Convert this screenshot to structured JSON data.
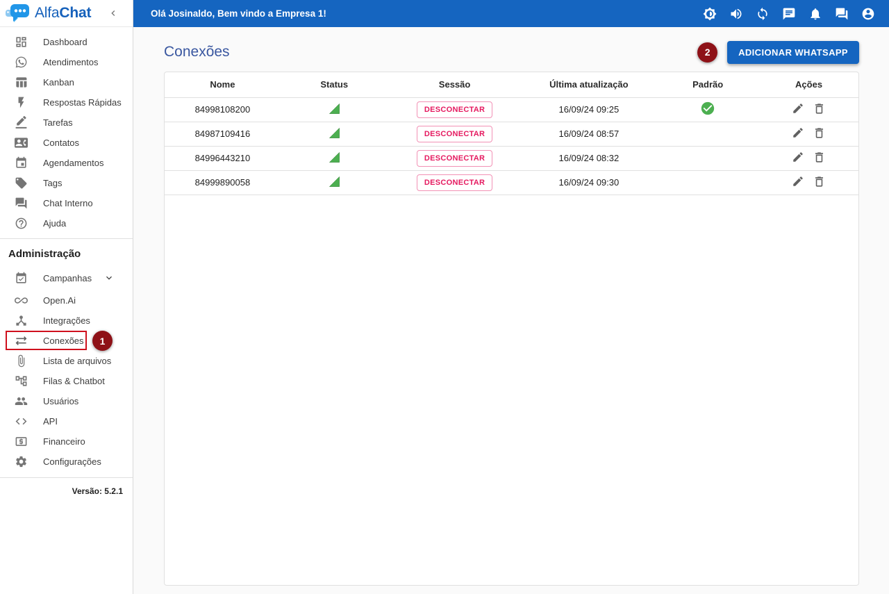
{
  "app": {
    "brand_alfa": "Alfa",
    "brand_chat": "Chat",
    "version_label": "Versão: 5.2.1"
  },
  "topbar": {
    "greeting": "Olá Josinaldo, Bem vindo a Empresa 1!",
    "icons": [
      "dark-mode-icon",
      "volume-icon",
      "sync-icon",
      "chat-icon",
      "notifications-icon",
      "internal-chat-icon",
      "account-icon"
    ]
  },
  "sidebar": {
    "items": [
      {
        "label": "Dashboard",
        "icon": "dashboard-icon"
      },
      {
        "label": "Atendimentos",
        "icon": "whatsapp-icon"
      },
      {
        "label": "Kanban",
        "icon": "kanban-icon"
      },
      {
        "label": "Respostas Rápidas",
        "icon": "flash-icon"
      },
      {
        "label": "Tarefas",
        "icon": "tasks-icon"
      },
      {
        "label": "Contatos",
        "icon": "contacts-icon"
      },
      {
        "label": "Agendamentos",
        "icon": "calendar-icon"
      },
      {
        "label": "Tags",
        "icon": "tag-icon"
      },
      {
        "label": "Chat Interno",
        "icon": "forum-icon"
      },
      {
        "label": "Ajuda",
        "icon": "help-icon"
      }
    ],
    "admin_section": "Administração",
    "admin_items": [
      {
        "label": "Campanhas",
        "icon": "campaigns-icon",
        "expandable": true
      },
      {
        "label": "Open.Ai",
        "icon": "infinity-icon"
      },
      {
        "label": "Integrações",
        "icon": "integrations-icon"
      },
      {
        "label": "Conexões",
        "icon": "connections-icon",
        "highlighted": true
      },
      {
        "label": "Lista de arquivos",
        "icon": "attachment-icon"
      },
      {
        "label": "Filas & Chatbot",
        "icon": "tree-icon"
      },
      {
        "label": "Usuários",
        "icon": "users-icon"
      },
      {
        "label": "API",
        "icon": "code-icon"
      },
      {
        "label": "Financeiro",
        "icon": "finance-icon"
      },
      {
        "label": "Configurações",
        "icon": "settings-icon"
      }
    ]
  },
  "main": {
    "title": "Conexões",
    "add_whatsapp_label": "ADICIONAR WHATSAPP",
    "table": {
      "headers": [
        "Nome",
        "Status",
        "Sessão",
        "Última atualização",
        "Padrão",
        "Ações"
      ],
      "rows": [
        {
          "nome": "84998108200",
          "status": "connected",
          "session_action": "DESCONECTAR",
          "updated": "16/09/24 09:25",
          "default": true
        },
        {
          "nome": "84987109416",
          "status": "connected",
          "session_action": "DESCONECTAR",
          "updated": "16/09/24 08:57",
          "default": false
        },
        {
          "nome": "84996443210",
          "status": "connected",
          "session_action": "DESCONECTAR",
          "updated": "16/09/24 08:32",
          "default": false
        },
        {
          "nome": "84999890058",
          "status": "connected",
          "session_action": "DESCONECTAR",
          "updated": "16/09/24 09:30",
          "default": false
        }
      ]
    }
  },
  "annotations": {
    "step1": "1",
    "step2": "2"
  },
  "colors": {
    "topbar_blue": "#1565c0",
    "title_blue": "#3a57a0",
    "status_green": "#4caf50",
    "disconnect_pink": "#e5195f",
    "annotation_red": "#8e1117",
    "annotation_box_red": "#cf101d"
  }
}
